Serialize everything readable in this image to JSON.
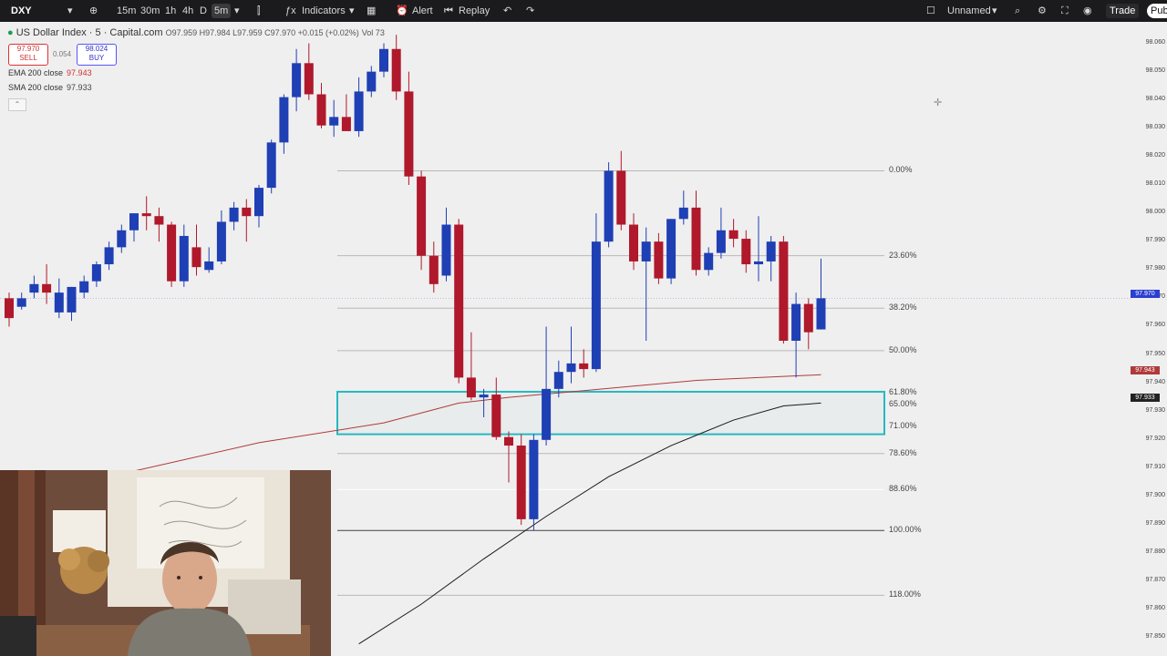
{
  "toolbar": {
    "symbol": "DXY",
    "timeframes": [
      "15m",
      "30m",
      "1h",
      "4h",
      "D",
      "5m"
    ],
    "active_timeframe": "5m",
    "indicators_label": "Indicators",
    "alert_label": "Alert",
    "replay_label": "Replay",
    "layout_name": "Unnamed",
    "trade_label": "Trade",
    "publish_label": "Pub"
  },
  "legend": {
    "title": "US Dollar Index · 5 · Capital.com",
    "ohlc": "O97.959 H97.984 L97.959 C97.970 +0.015 (+0.02%)",
    "volume": "Vol 73",
    "sell": {
      "price": "97.970",
      "label": "SELL"
    },
    "spread": "0.054",
    "buy": {
      "price": "98.024",
      "label": "BUY"
    },
    "ema": {
      "name": "EMA 200 close",
      "value": "97.943"
    },
    "sma": {
      "name": "SMA 200 close",
      "value": "97.933"
    }
  },
  "fib_levels": [
    "0.00%",
    "23.60%",
    "38.20%",
    "50.00%",
    "61.80%",
    "65.00%",
    "71.00%",
    "78.60%",
    "88.60%",
    "100.00%",
    "118.00%"
  ],
  "price_scale": [
    "98.060",
    "98.050",
    "98.040",
    "98.030",
    "98.020",
    "98.010",
    "98.000",
    "97.990",
    "97.980",
    "97.970",
    "97.960",
    "97.950",
    "97.940",
    "97.930",
    "97.920",
    "97.910",
    "97.900",
    "97.890",
    "97.880",
    "97.870",
    "97.860",
    "97.850"
  ],
  "price_tags": {
    "last": "97.970",
    "ema": "97.943",
    "sma": "97.933"
  },
  "colors": {
    "bull": "#1f3fb5",
    "bear": "#b0182b",
    "ema": "#b03a3a",
    "sma": "#1a1a1a",
    "zone": "#28b8c0"
  },
  "chart_data": {
    "type": "candlestick",
    "title": "US Dollar Index · 5 · Capital.com",
    "ylim": [
      97.845,
      98.065
    ],
    "candles": [
      {
        "o": 97.97,
        "h": 97.972,
        "l": 97.96,
        "c": 97.963
      },
      {
        "o": 97.967,
        "h": 97.972,
        "l": 97.966,
        "c": 97.97
      },
      {
        "o": 97.972,
        "h": 97.978,
        "l": 97.97,
        "c": 97.975
      },
      {
        "o": 97.975,
        "h": 97.982,
        "l": 97.968,
        "c": 97.972
      },
      {
        "o": 97.965,
        "h": 97.977,
        "l": 97.963,
        "c": 97.972
      },
      {
        "o": 97.965,
        "h": 97.974,
        "l": 97.962,
        "c": 97.974
      },
      {
        "o": 97.972,
        "h": 97.978,
        "l": 97.97,
        "c": 97.976
      },
      {
        "o": 97.976,
        "h": 97.983,
        "l": 97.974,
        "c": 97.982
      },
      {
        "o": 97.982,
        "h": 97.99,
        "l": 97.98,
        "c": 97.988
      },
      {
        "o": 97.988,
        "h": 97.996,
        "l": 97.986,
        "c": 97.994
      },
      {
        "o": 97.994,
        "h": 98.0,
        "l": 97.99,
        "c": 98.0
      },
      {
        "o": 98.0,
        "h": 98.006,
        "l": 97.994,
        "c": 97.999
      },
      {
        "o": 97.999,
        "h": 98.002,
        "l": 97.99,
        "c": 97.996
      },
      {
        "o": 97.996,
        "h": 97.997,
        "l": 97.974,
        "c": 97.976
      },
      {
        "o": 97.976,
        "h": 97.996,
        "l": 97.974,
        "c": 97.992
      },
      {
        "o": 97.988,
        "h": 97.996,
        "l": 97.978,
        "c": 97.981
      },
      {
        "o": 97.98,
        "h": 97.988,
        "l": 97.979,
        "c": 97.983
      },
      {
        "o": 97.983,
        "h": 98.001,
        "l": 97.982,
        "c": 97.997
      },
      {
        "o": 97.997,
        "h": 98.004,
        "l": 97.994,
        "c": 98.002
      },
      {
        "o": 98.002,
        "h": 98.005,
        "l": 97.99,
        "c": 97.999
      },
      {
        "o": 97.999,
        "h": 98.01,
        "l": 97.995,
        "c": 98.009
      },
      {
        "o": 98.009,
        "h": 98.026,
        "l": 98.007,
        "c": 98.025
      },
      {
        "o": 98.025,
        "h": 98.042,
        "l": 98.021,
        "c": 98.041
      },
      {
        "o": 98.041,
        "h": 98.058,
        "l": 98.036,
        "c": 98.053
      },
      {
        "o": 98.053,
        "h": 98.06,
        "l": 98.04,
        "c": 98.042
      },
      {
        "o": 98.042,
        "h": 98.046,
        "l": 98.03,
        "c": 98.031
      },
      {
        "o": 98.031,
        "h": 98.04,
        "l": 98.027,
        "c": 98.034
      },
      {
        "o": 98.034,
        "h": 98.042,
        "l": 98.029,
        "c": 98.029
      },
      {
        "o": 98.029,
        "h": 98.048,
        "l": 98.027,
        "c": 98.043
      },
      {
        "o": 98.043,
        "h": 98.052,
        "l": 98.041,
        "c": 98.05
      },
      {
        "o": 98.05,
        "h": 98.06,
        "l": 98.048,
        "c": 98.058
      },
      {
        "o": 98.058,
        "h": 98.063,
        "l": 98.04,
        "c": 98.043
      },
      {
        "o": 98.043,
        "h": 98.05,
        "l": 98.01,
        "c": 98.013
      },
      {
        "o": 98.013,
        "h": 98.015,
        "l": 97.98,
        "c": 97.985
      },
      {
        "o": 97.985,
        "h": 97.99,
        "l": 97.972,
        "c": 97.975
      },
      {
        "o": 97.978,
        "h": 98.002,
        "l": 97.976,
        "c": 97.996
      },
      {
        "o": 97.996,
        "h": 97.998,
        "l": 97.94,
        "c": 97.942
      },
      {
        "o": 97.942,
        "h": 97.958,
        "l": 97.934,
        "c": 97.935
      },
      {
        "o": 97.935,
        "h": 97.938,
        "l": 97.928,
        "c": 97.936
      },
      {
        "o": 97.936,
        "h": 97.942,
        "l": 97.92,
        "c": 97.921
      },
      {
        "o": 97.921,
        "h": 97.923,
        "l": 97.905,
        "c": 97.918
      },
      {
        "o": 97.918,
        "h": 97.922,
        "l": 97.89,
        "c": 97.892
      },
      {
        "o": 97.892,
        "h": 97.922,
        "l": 97.888,
        "c": 97.92
      },
      {
        "o": 97.92,
        "h": 97.96,
        "l": 97.918,
        "c": 97.938
      },
      {
        "o": 97.938,
        "h": 97.948,
        "l": 97.935,
        "c": 97.944
      },
      {
        "o": 97.944,
        "h": 97.96,
        "l": 97.94,
        "c": 97.947
      },
      {
        "o": 97.947,
        "h": 97.952,
        "l": 97.942,
        "c": 97.945
      },
      {
        "o": 97.945,
        "h": 98.0,
        "l": 97.944,
        "c": 97.99
      },
      {
        "o": 97.99,
        "h": 98.018,
        "l": 97.988,
        "c": 98.015
      },
      {
        "o": 98.015,
        "h": 98.022,
        "l": 97.994,
        "c": 97.996
      },
      {
        "o": 97.996,
        "h": 98.0,
        "l": 97.98,
        "c": 97.983
      },
      {
        "o": 97.983,
        "h": 97.995,
        "l": 97.955,
        "c": 97.99
      },
      {
        "o": 97.99,
        "h": 97.993,
        "l": 97.975,
        "c": 97.977
      },
      {
        "o": 97.977,
        "h": 97.998,
        "l": 97.975,
        "c": 97.998
      },
      {
        "o": 97.998,
        "h": 98.008,
        "l": 97.996,
        "c": 98.002
      },
      {
        "o": 98.002,
        "h": 98.008,
        "l": 97.978,
        "c": 97.98
      },
      {
        "o": 97.98,
        "h": 97.988,
        "l": 97.978,
        "c": 97.986
      },
      {
        "o": 97.986,
        "h": 98.002,
        "l": 97.984,
        "c": 97.994
      },
      {
        "o": 97.994,
        "h": 97.998,
        "l": 97.988,
        "c": 97.991
      },
      {
        "o": 97.991,
        "h": 97.994,
        "l": 97.979,
        "c": 97.982
      },
      {
        "o": 97.982,
        "h": 97.999,
        "l": 97.976,
        "c": 97.983
      },
      {
        "o": 97.983,
        "h": 97.992,
        "l": 97.976,
        "c": 97.99
      },
      {
        "o": 97.99,
        "h": 97.992,
        "l": 97.954,
        "c": 97.955
      },
      {
        "o": 97.955,
        "h": 97.972,
        "l": 97.942,
        "c": 97.968
      },
      {
        "o": 97.968,
        "h": 97.97,
        "l": 97.952,
        "c": 97.958
      },
      {
        "o": 97.959,
        "h": 97.984,
        "l": 97.959,
        "c": 97.97
      }
    ],
    "fib": {
      "top": 98.015,
      "bottom": 97.888
    },
    "zone": {
      "high": 97.937,
      "low": 97.922
    },
    "ema200": [
      [
        0,
        97.9
      ],
      [
        10,
        97.909
      ],
      [
        20,
        97.919
      ],
      [
        30,
        97.926
      ],
      [
        36,
        97.933
      ],
      [
        40,
        97.935
      ],
      [
        45,
        97.937
      ],
      [
        50,
        97.939
      ],
      [
        55,
        97.941
      ],
      [
        60,
        97.942
      ],
      [
        65,
        97.943
      ]
    ],
    "sma200": [
      [
        28,
        97.848
      ],
      [
        33,
        97.862
      ],
      [
        38,
        97.878
      ],
      [
        43,
        97.893
      ],
      [
        48,
        97.907
      ],
      [
        53,
        97.918
      ],
      [
        58,
        97.927
      ],
      [
        62,
        97.932
      ],
      [
        65,
        97.933
      ]
    ]
  }
}
